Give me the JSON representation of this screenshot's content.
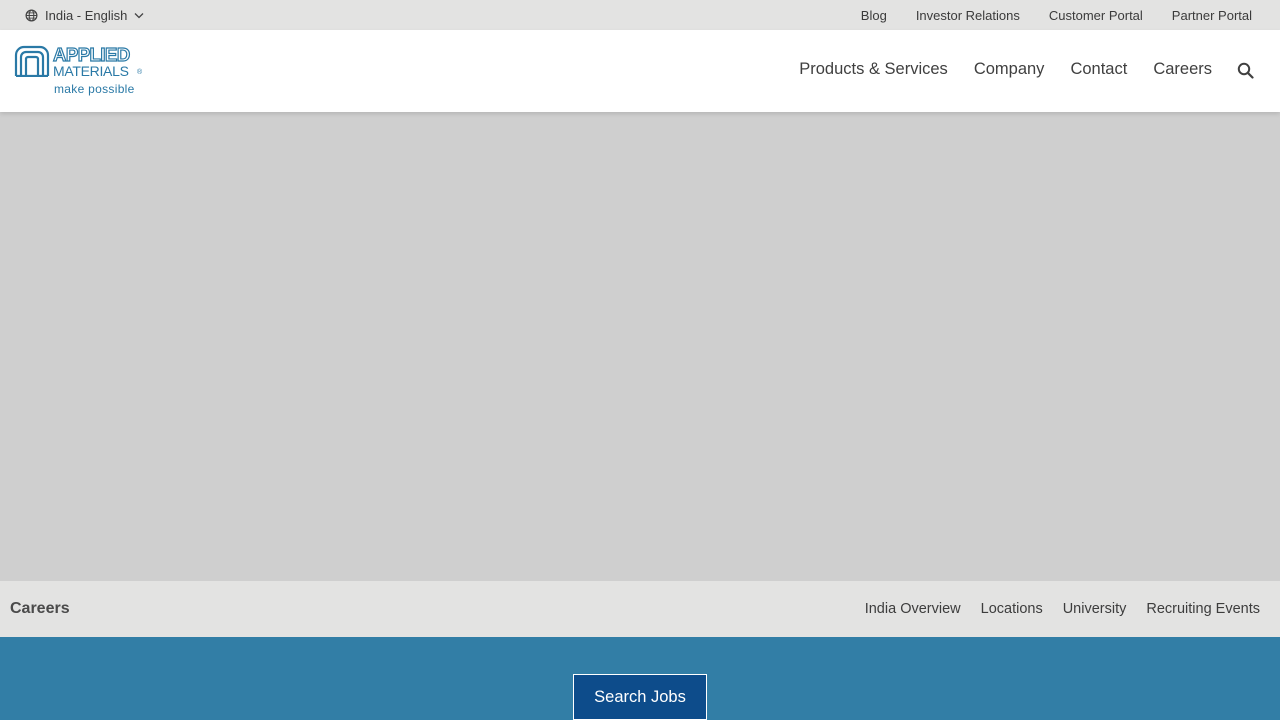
{
  "utility_bar": {
    "language": "India - English",
    "links": [
      "Blog",
      "Investor Relations",
      "Customer Portal",
      "Partner Portal"
    ]
  },
  "logo": {
    "line1": "APPLIED",
    "line2": "MATERIALS",
    "registered": "®",
    "tagline": "make possible",
    "brand_color": "#2a79a6"
  },
  "main_nav": {
    "items": [
      "Products & Services",
      "Company",
      "Contact",
      "Careers"
    ],
    "search_icon": "search-icon"
  },
  "hero": {
    "placeholder_color": "#cfcfcf"
  },
  "sub_nav": {
    "title": "Careers",
    "links": [
      "India Overview",
      "Locations",
      "University",
      "Recruiting Events"
    ]
  },
  "cta": {
    "search_jobs_label": "Search Jobs",
    "band_color": "#327ea6",
    "button_color": "#0d4c8b"
  }
}
